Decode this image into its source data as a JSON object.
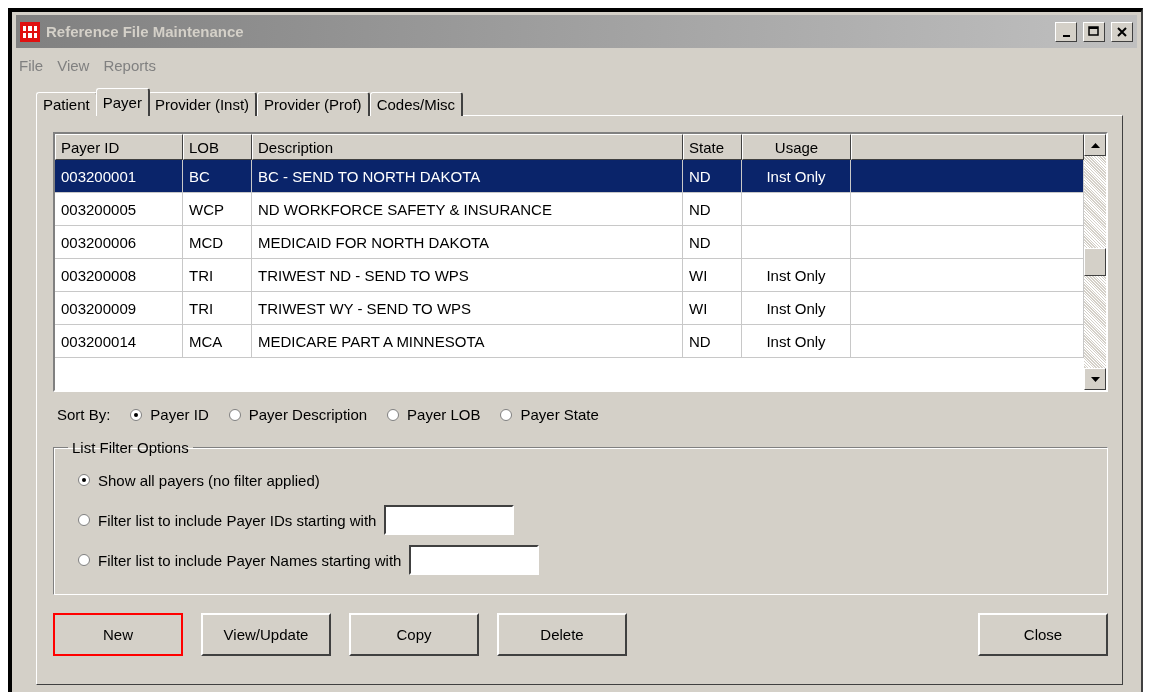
{
  "window": {
    "title": "Reference File Maintenance",
    "controls": [
      {
        "kind": "minimize"
      },
      {
        "kind": "maximize"
      },
      {
        "kind": "close"
      }
    ]
  },
  "menu": [
    {
      "label": "File",
      "disabled": true
    },
    {
      "label": "View",
      "disabled": true
    },
    {
      "label": "Reports",
      "disabled": true
    }
  ],
  "tabs": [
    {
      "label": "Patient",
      "selected": false
    },
    {
      "label": "Payer",
      "selected": true
    },
    {
      "label": "Provider (Inst)",
      "selected": false
    },
    {
      "label": "Provider (Prof)",
      "selected": false
    },
    {
      "label": "Codes/Misc",
      "selected": false
    }
  ],
  "table": {
    "columns": [
      "Payer ID",
      "LOB",
      "Description",
      "State",
      "Usage"
    ],
    "rows": [
      {
        "cells": [
          "003200001",
          "BC",
          "BC - SEND TO NORTH DAKOTA",
          "ND",
          "Inst Only"
        ],
        "selected": true
      },
      {
        "cells": [
          "003200005",
          "WCP",
          "ND WORKFORCE SAFETY & INSURANCE",
          "ND",
          ""
        ],
        "selected": false
      },
      {
        "cells": [
          "003200006",
          "MCD",
          "MEDICAID FOR NORTH DAKOTA",
          "ND",
          ""
        ],
        "selected": false
      },
      {
        "cells": [
          "003200008",
          "TRI",
          "TRIWEST ND - SEND TO WPS",
          "WI",
          "Inst Only"
        ],
        "selected": false
      },
      {
        "cells": [
          "003200009",
          "TRI",
          "TRIWEST WY - SEND TO WPS",
          "WI",
          "Inst Only"
        ],
        "selected": false
      },
      {
        "cells": [
          "003200014",
          "MCA",
          "MEDICARE PART A MINNESOTA",
          "ND",
          "Inst Only"
        ],
        "selected": false
      }
    ]
  },
  "sort_by": {
    "label": "Sort By:",
    "options": [
      {
        "label": "Payer ID",
        "selected": true
      },
      {
        "label": "Payer Description",
        "selected": false
      },
      {
        "label": "Payer LOB",
        "selected": false
      },
      {
        "label": "Payer State",
        "selected": false
      }
    ]
  },
  "filter_options": {
    "title": "List Filter Options",
    "options": [
      {
        "kind": "plain",
        "label": "Show all payers (no filter applied)",
        "selected": true
      },
      {
        "kind": "text",
        "label": "Filter list to include Payer IDs starting with",
        "selected": false
      },
      {
        "kind": "text",
        "label": "Filter list to include Payer Names starting with",
        "selected": false
      }
    ]
  },
  "buttons": [
    {
      "label": "New",
      "highlighted": true
    },
    {
      "label": "View/Update",
      "highlighted": false
    },
    {
      "label": "Copy",
      "highlighted": false
    },
    {
      "label": "Delete",
      "highlighted": false
    }
  ],
  "close_button": {
    "label": "Close",
    "highlighted": false
  }
}
